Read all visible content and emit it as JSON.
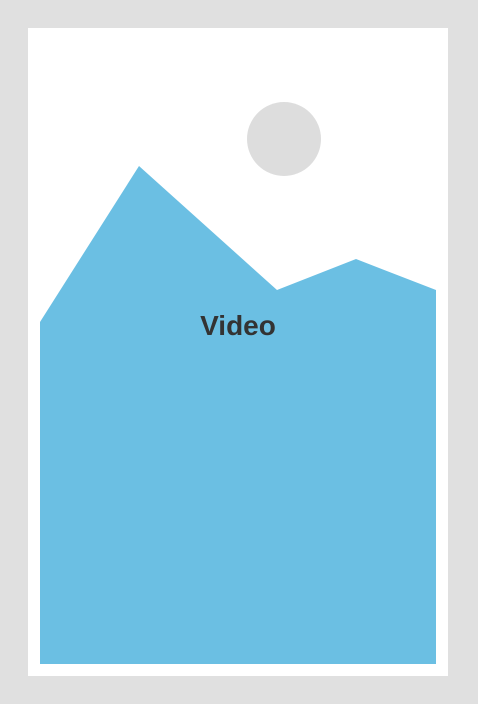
{
  "video_placeholder": {
    "label": "Video",
    "icon": "image-placeholder-icon",
    "colors": {
      "background": "#e0e0e0",
      "frame": "#ffffff",
      "mountain": "#6bbfe3",
      "sun": "#dddddd",
      "label": "#333333"
    }
  }
}
